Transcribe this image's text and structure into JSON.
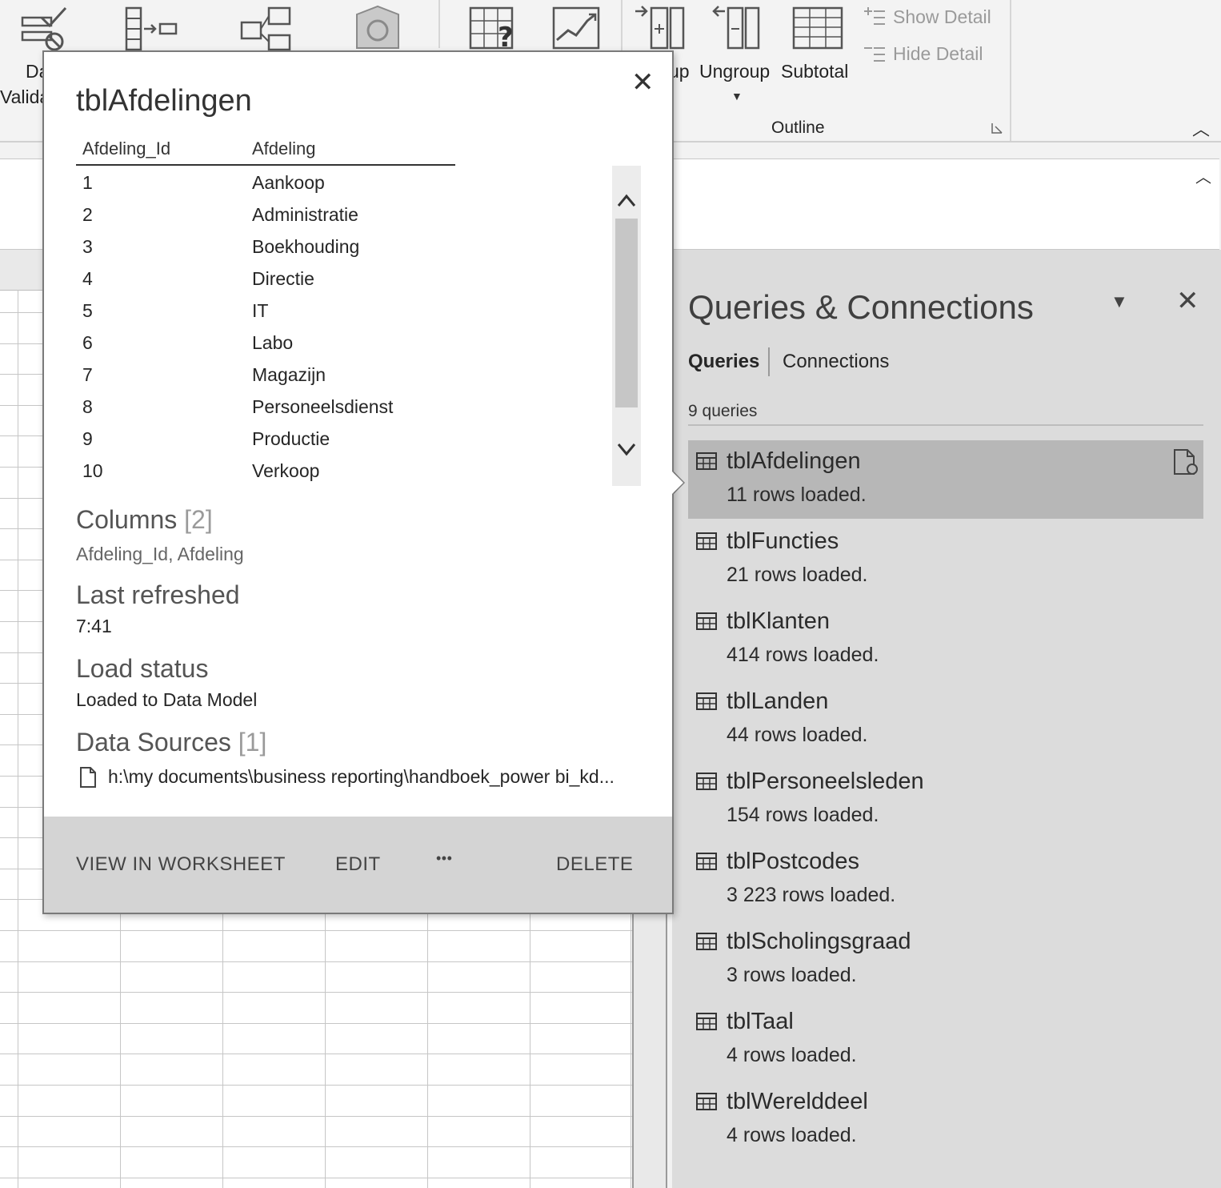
{
  "ribbon": {
    "data_validation_label_1": "Da",
    "data_validation_label_2": "Valida",
    "ungroup_label": "Ungroup",
    "group_label_fragment": "up",
    "subtotal_label": "Subtotal",
    "show_detail_label": "Show Detail",
    "hide_detail_label": "Hide Detail",
    "outline_group_label": "Outline"
  },
  "popup": {
    "title": "tblAfdelingen",
    "preview": {
      "headers": [
        "Afdeling_Id",
        "Afdeling"
      ],
      "rows": [
        [
          "1",
          "Aankoop"
        ],
        [
          "2",
          "Administratie"
        ],
        [
          "3",
          "Boekhouding"
        ],
        [
          "4",
          "Directie"
        ],
        [
          "5",
          "IT"
        ],
        [
          "6",
          "Labo"
        ],
        [
          "7",
          "Magazijn"
        ],
        [
          "8",
          "Personeelsdienst"
        ],
        [
          "9",
          "Productie"
        ],
        [
          "10",
          "Verkoop"
        ]
      ]
    },
    "columns_heading": "Columns",
    "columns_count": "[2]",
    "columns_list": "Afdeling_Id, Afdeling",
    "last_refreshed_heading": "Last refreshed",
    "last_refreshed_value": "7:41",
    "load_status_heading": "Load status",
    "load_status_value": "Loaded to Data Model",
    "data_sources_heading": "Data Sources",
    "data_sources_count": "[1]",
    "data_source_path": "h:\\my documents\\business reporting\\handboek_power bi_kd...",
    "footer": {
      "view_in_worksheet": "VIEW IN WORKSHEET",
      "edit": "EDIT",
      "more": "•••",
      "delete": "DELETE"
    }
  },
  "pane": {
    "title": "Queries & Connections",
    "tabs": [
      "Queries",
      "Connections"
    ],
    "query_count": "9 queries",
    "queries": [
      {
        "name": "tblAfdelingen",
        "rows": "11 rows loaded."
      },
      {
        "name": "tblFuncties",
        "rows": "21 rows loaded."
      },
      {
        "name": "tblKlanten",
        "rows": "414 rows loaded."
      },
      {
        "name": "tblLanden",
        "rows": "44 rows loaded."
      },
      {
        "name": "tblPersoneelsleden",
        "rows": "154 rows loaded."
      },
      {
        "name": "tblPostcodes",
        "rows": "3 223 rows loaded."
      },
      {
        "name": "tblScholingsgraad",
        "rows": "3 rows loaded."
      },
      {
        "name": "tblTaal",
        "rows": "4 rows loaded."
      },
      {
        "name": "tblWerelddeel",
        "rows": "4 rows loaded."
      }
    ]
  }
}
